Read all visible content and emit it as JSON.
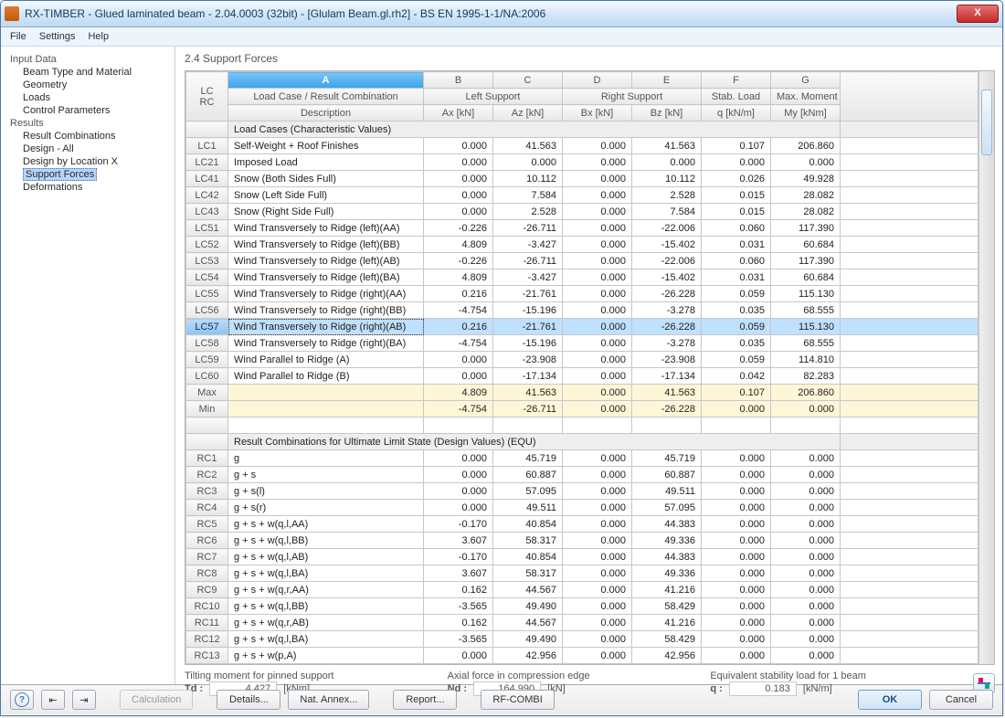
{
  "window": {
    "title": "RX-TIMBER - Glued laminated beam - 2.04.0003 (32bit) - [Glulam Beam.gl.rh2] - BS EN 1995-1-1/NA:2006",
    "close": "X"
  },
  "menu": {
    "file": "File",
    "settings": "Settings",
    "help": "Help"
  },
  "nav": {
    "input_header": "Input Data",
    "beam_type": "Beam Type and Material",
    "geometry": "Geometry",
    "loads": "Loads",
    "ctrl_params": "Control Parameters",
    "results_header": "Results",
    "result_comb": "Result Combinations",
    "design_all": "Design - All",
    "design_loc": "Design by Location X",
    "support_forces": "Support Forces",
    "deformations": "Deformations"
  },
  "main": {
    "heading": "2.4 Support Forces",
    "cols": {
      "A": "A",
      "B": "B",
      "C": "C",
      "D": "D",
      "E": "E",
      "F": "F",
      "G": "G"
    },
    "hdr": {
      "lcrc1": "LC",
      "lcrc2": "RC",
      "caseline1": "Load Case / Result Combination",
      "caseline2": "Description",
      "left": "Left Support",
      "right": "Right Support",
      "stab": "Stab. Load",
      "moment": "Max. Moment",
      "ax": "Ax [kN]",
      "az": "Az [kN]",
      "bx": "Bx [kN]",
      "bz": "Bz [kN]",
      "q": "q [kN/m]",
      "my": "My [kNm]"
    },
    "section1": "Load Cases (Characteristic Values)",
    "section2": "Result Combinations for Ultimate Limit State (Design Values) (EQU)",
    "max": "Max",
    "min": "Min",
    "lc_rows": [
      {
        "id": "LC1",
        "d": "Self-Weight + Roof Finishes",
        "v": [
          "0.000",
          "41.563",
          "0.000",
          "41.563",
          "0.107",
          "206.860"
        ]
      },
      {
        "id": "LC21",
        "d": "Imposed Load",
        "v": [
          "0.000",
          "0.000",
          "0.000",
          "0.000",
          "0.000",
          "0.000"
        ]
      },
      {
        "id": "LC41",
        "d": "Snow (Both Sides Full)",
        "v": [
          "0.000",
          "10.112",
          "0.000",
          "10.112",
          "0.026",
          "49.928"
        ]
      },
      {
        "id": "LC42",
        "d": "Snow (Left Side Full)",
        "v": [
          "0.000",
          "7.584",
          "0.000",
          "2.528",
          "0.015",
          "28.082"
        ]
      },
      {
        "id": "LC43",
        "d": "Snow (Right Side Full)",
        "v": [
          "0.000",
          "2.528",
          "0.000",
          "7.584",
          "0.015",
          "28.082"
        ]
      },
      {
        "id": "LC51",
        "d": "Wind Transversely to Ridge (left)(AA)",
        "v": [
          "-0.226",
          "-26.711",
          "0.000",
          "-22.006",
          "0.060",
          "117.390"
        ]
      },
      {
        "id": "LC52",
        "d": "Wind Transversely to Ridge (left)(BB)",
        "v": [
          "4.809",
          "-3.427",
          "0.000",
          "-15.402",
          "0.031",
          "60.684"
        ]
      },
      {
        "id": "LC53",
        "d": "Wind Transversely to Ridge (left)(AB)",
        "v": [
          "-0.226",
          "-26.711",
          "0.000",
          "-22.006",
          "0.060",
          "117.390"
        ]
      },
      {
        "id": "LC54",
        "d": "Wind Transversely to Ridge (left)(BA)",
        "v": [
          "4.809",
          "-3.427",
          "0.000",
          "-15.402",
          "0.031",
          "60.684"
        ]
      },
      {
        "id": "LC55",
        "d": "Wind Transversely to Ridge (right)(AA)",
        "v": [
          "0.216",
          "-21.761",
          "0.000",
          "-26.228",
          "0.059",
          "115.130"
        ]
      },
      {
        "id": "LC56",
        "d": "Wind Transversely to Ridge (right)(BB)",
        "v": [
          "-4.754",
          "-15.196",
          "0.000",
          "-3.278",
          "0.035",
          "68.555"
        ]
      },
      {
        "id": "LC57",
        "d": "Wind Transversely to Ridge (right)(AB)",
        "v": [
          "0.216",
          "-21.761",
          "0.000",
          "-26.228",
          "0.059",
          "115.130"
        ],
        "sel": true
      },
      {
        "id": "LC58",
        "d": "Wind Transversely to Ridge (right)(BA)",
        "v": [
          "-4.754",
          "-15.196",
          "0.000",
          "-3.278",
          "0.035",
          "68.555"
        ]
      },
      {
        "id": "LC59",
        "d": "Wind Parallel to Ridge (A)",
        "v": [
          "0.000",
          "-23.908",
          "0.000",
          "-23.908",
          "0.059",
          "114.810"
        ]
      },
      {
        "id": "LC60",
        "d": "Wind Parallel to Ridge (B)",
        "v": [
          "0.000",
          "-17.134",
          "0.000",
          "-17.134",
          "0.042",
          "82.283"
        ]
      }
    ],
    "max_row": {
      "v": [
        "4.809",
        "41.563",
        "0.000",
        "41.563",
        "0.107",
        "206.860"
      ]
    },
    "min_row": {
      "v": [
        "-4.754",
        "-26.711",
        "0.000",
        "-26.228",
        "0.000",
        "0.000"
      ]
    },
    "rc_rows": [
      {
        "id": "RC1",
        "d": "g",
        "v": [
          "0.000",
          "45.719",
          "0.000",
          "45.719",
          "0.000",
          "0.000"
        ]
      },
      {
        "id": "RC2",
        "d": "g + s",
        "v": [
          "0.000",
          "60.887",
          "0.000",
          "60.887",
          "0.000",
          "0.000"
        ]
      },
      {
        "id": "RC3",
        "d": "g + s(l)",
        "v": [
          "0.000",
          "57.095",
          "0.000",
          "49.511",
          "0.000",
          "0.000"
        ]
      },
      {
        "id": "RC4",
        "d": "g + s(r)",
        "v": [
          "0.000",
          "49.511",
          "0.000",
          "57.095",
          "0.000",
          "0.000"
        ]
      },
      {
        "id": "RC5",
        "d": "g + s + w(q,l,AA)",
        "v": [
          "-0.170",
          "40.854",
          "0.000",
          "44.383",
          "0.000",
          "0.000"
        ]
      },
      {
        "id": "RC6",
        "d": "g + s + w(q,l,BB)",
        "v": [
          "3.607",
          "58.317",
          "0.000",
          "49.336",
          "0.000",
          "0.000"
        ]
      },
      {
        "id": "RC7",
        "d": "g + s + w(q,l,AB)",
        "v": [
          "-0.170",
          "40.854",
          "0.000",
          "44.383",
          "0.000",
          "0.000"
        ]
      },
      {
        "id": "RC8",
        "d": "g + s + w(q,l,BA)",
        "v": [
          "3.607",
          "58.317",
          "0.000",
          "49.336",
          "0.000",
          "0.000"
        ]
      },
      {
        "id": "RC9",
        "d": "g + s + w(q,r,AA)",
        "v": [
          "0.162",
          "44.567",
          "0.000",
          "41.216",
          "0.000",
          "0.000"
        ]
      },
      {
        "id": "RC10",
        "d": "g + s + w(q,l,BB)",
        "v": [
          "-3.565",
          "49.490",
          "0.000",
          "58.429",
          "0.000",
          "0.000"
        ]
      },
      {
        "id": "RC11",
        "d": "g + s + w(q,r,AB)",
        "v": [
          "0.162",
          "44.567",
          "0.000",
          "41.216",
          "0.000",
          "0.000"
        ]
      },
      {
        "id": "RC12",
        "d": "g + s + w(q,l,BA)",
        "v": [
          "-3.565",
          "49.490",
          "0.000",
          "58.429",
          "0.000",
          "0.000"
        ]
      },
      {
        "id": "RC13",
        "d": "g + s + w(p,A)",
        "v": [
          "0.000",
          "42.956",
          "0.000",
          "42.956",
          "0.000",
          "0.000"
        ]
      }
    ]
  },
  "summary": {
    "tilting_label": "Tilting moment for pinned support",
    "td_label": "Td :",
    "td_value": "4.427",
    "td_unit": "[kNm]",
    "axial_label": "Axial force in compression edge",
    "nd_label": "Nd :",
    "nd_value": "164.990",
    "nd_unit": "[kN]",
    "eq_label": "Equivalent stability load for 1 beam",
    "q_label": "q :",
    "q_value": "0.183",
    "q_unit": "[kN/m]"
  },
  "footer": {
    "calc": "Calculation",
    "details": "Details...",
    "annex": "Nat. Annex...",
    "report": "Report...",
    "combi": "RF-COMBI",
    "ok": "OK",
    "cancel": "Cancel",
    "help": "?",
    "prev": "⇤",
    "next": "⇥"
  }
}
